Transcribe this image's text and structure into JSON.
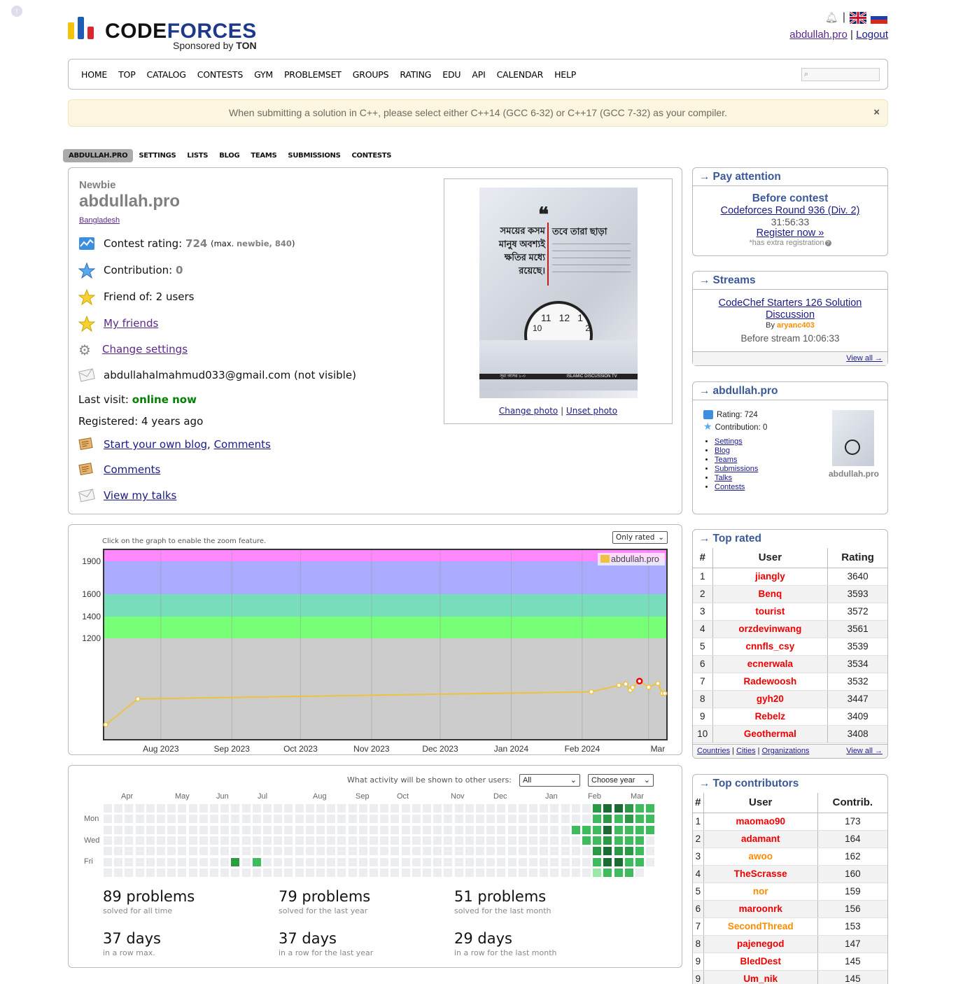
{
  "header": {
    "logo_word1": "CODE",
    "logo_word2": "FORCES",
    "sponsor_prefix": "Sponsored by",
    "sponsor": "TON",
    "user_handle": "abdullah.pro",
    "logout": "Logout",
    "separator": "|"
  },
  "menu": [
    "HOME",
    "TOP",
    "CATALOG",
    "CONTESTS",
    "GYM",
    "PROBLEMSET",
    "GROUPS",
    "RATING",
    "EDU",
    "API",
    "CALENDAR",
    "HELP"
  ],
  "alert": {
    "text": "When submitting a solution in C++, please select either C++14 (GCC 6-32) or C++17 (GCC 7-32) as your compiler.",
    "close": "×"
  },
  "profile_tabs": [
    "ABDULLAH.PRO",
    "SETTINGS",
    "LISTS",
    "BLOG",
    "TEAMS",
    "SUBMISSIONS",
    "CONTESTS"
  ],
  "profile": {
    "rank": "Newbie",
    "handle": "abdullah.pro",
    "country": "Bangladesh",
    "contest_rating_label": "Contest rating:",
    "rating": "724",
    "max_prefix": "(max.",
    "max_rank": "newbie, 840",
    "max_suffix": ")",
    "contribution_label": "Contribution:",
    "contribution": "0",
    "friend_of": "Friend of: 2 users",
    "my_friends": "My friends",
    "change_settings": "Change settings",
    "email": "abdullahalmahmud033@gmail.com (not visible)",
    "last_visit_label": "Last visit:",
    "last_visit": "online now",
    "registered": "Registered: 4 years ago",
    "start_blog": "Start your own blog",
    "comments": "Comments",
    "comments2": "Comments",
    "view_talks": "View my talks",
    "change_photo": "Change photo",
    "unset_photo": "Unset photo",
    "photo_text_right": "তবে তারা ছাড়া",
    "photo_text_left": "সময়ের কসম মানুষ অবশ্যই ক্ষতির মধ্যে রয়েছে।",
    "photo_footer_left": "সূরা আসর ১-৩",
    "photo_footer_right": "ISLAMIC DISCUSSION TV",
    "clock_numbers": [
      "11",
      "12",
      "1",
      "2",
      "10"
    ]
  },
  "pay_attention": {
    "title": "Pay attention",
    "before": "Before contest",
    "contest": "Codeforces Round 936 (Div. 2)",
    "countdown": "31:56:33",
    "register": "Register now »",
    "note": "*has extra registration"
  },
  "streams": {
    "title": "Streams",
    "name": "CodeChef Starters 126 Solution Discussion",
    "by": "By",
    "author": "aryanc403",
    "before": "Before stream 10:06:33",
    "view_all": "View all →"
  },
  "user_box": {
    "title": "abdullah.pro",
    "rating": "Rating: 724",
    "contribution": "Contribution: 0",
    "links": [
      "Settings",
      "Blog",
      "Teams",
      "Submissions",
      "Talks",
      "Contests"
    ],
    "caption": "abdullah.pro"
  },
  "top_rated": {
    "title": "Top rated",
    "cols": [
      "#",
      "User",
      "Rating"
    ],
    "rows": [
      [
        "1",
        "jiangly",
        "3640"
      ],
      [
        "2",
        "Benq",
        "3593"
      ],
      [
        "3",
        "tourist",
        "3572"
      ],
      [
        "4",
        "orzdevinwang",
        "3561"
      ],
      [
        "5",
        "cnnfls_csy",
        "3539"
      ],
      [
        "6",
        "ecnerwala",
        "3534"
      ],
      [
        "7",
        "Radewoosh",
        "3532"
      ],
      [
        "8",
        "gyh20",
        "3447"
      ],
      [
        "9",
        "Rebelz",
        "3409"
      ],
      [
        "10",
        "Geothermal",
        "3408"
      ]
    ],
    "footer_links": [
      "Countries",
      "Cities",
      "Organizations"
    ],
    "view_all": "View all →"
  },
  "top_contributors": {
    "title": "Top contributors",
    "cols": [
      "#",
      "User",
      "Contrib."
    ],
    "rows": [
      [
        "1",
        "maomao90",
        "173",
        "red"
      ],
      [
        "2",
        "adamant",
        "164",
        "red"
      ],
      [
        "3",
        "awoo",
        "162",
        "orange"
      ],
      [
        "4",
        "TheScrasse",
        "160",
        "red"
      ],
      [
        "5",
        "nor",
        "159",
        "orange"
      ],
      [
        "6",
        "maroonrk",
        "156",
        "red"
      ],
      [
        "7",
        "SecondThread",
        "153",
        "orange"
      ],
      [
        "8",
        "pajenegod",
        "147",
        "red"
      ],
      [
        "9",
        "BledDest",
        "145",
        "red"
      ],
      [
        "9",
        "Um_nik",
        "145",
        "red"
      ]
    ]
  },
  "rating_graph": {
    "hint": "Click on the graph to enable the zoom feature.",
    "filter": "Only rated",
    "legend": "abdullah.pro",
    "yticks": [
      "1900",
      "1600",
      "1400",
      "1200"
    ],
    "xticks": [
      "Aug 2023",
      "Sep 2023",
      "Oct 2023",
      "Nov 2023",
      "Dec 2023",
      "Jan 2024",
      "Feb 2024",
      "Mar",
      "2024"
    ]
  },
  "chart_data": {
    "type": "line",
    "title": "",
    "xlabel": "",
    "ylabel": "",
    "series": [
      {
        "name": "abdullah.pro",
        "x": [
          "2023-07-08",
          "2023-07-22",
          "2024-02-05",
          "2024-02-17",
          "2024-02-20",
          "2024-02-22",
          "2024-02-23",
          "2024-02-26",
          "2024-03-01",
          "2024-03-05",
          "2024-03-07",
          "2024-03-08"
        ],
        "y": [
          434,
          662,
          725,
          783,
          794,
          740,
          763,
          820,
          766,
          800,
          711,
          711
        ]
      }
    ],
    "ylim": [
      0,
      2000
    ],
    "color_bands": [
      "#ccc",
      "#77ff77",
      "#77ddbb",
      "#aaaaff",
      "#ff88ff"
    ],
    "max_rating_point": 840
  },
  "activity": {
    "question": "What activity will be shown to other users:",
    "filter": "All",
    "year": "Choose year",
    "months": [
      "Apr",
      "May",
      "Jun",
      "Jul",
      "Aug",
      "Sep",
      "Oct",
      "Nov",
      "Dec",
      "Jan",
      "Feb",
      "Mar"
    ],
    "days": [
      "Mon",
      "Wed",
      "Fri"
    ],
    "stats": [
      {
        "n": "89 problems",
        "d": "solved for all time"
      },
      {
        "n": "79 problems",
        "d": "solved for the last year"
      },
      {
        "n": "51 problems",
        "d": "solved for the last month"
      },
      {
        "n": "37 days",
        "d": "in a row max."
      },
      {
        "n": "37 days",
        "d": "in a row for the last year"
      },
      {
        "n": "29 days",
        "d": "in a row for the last month"
      }
    ]
  }
}
